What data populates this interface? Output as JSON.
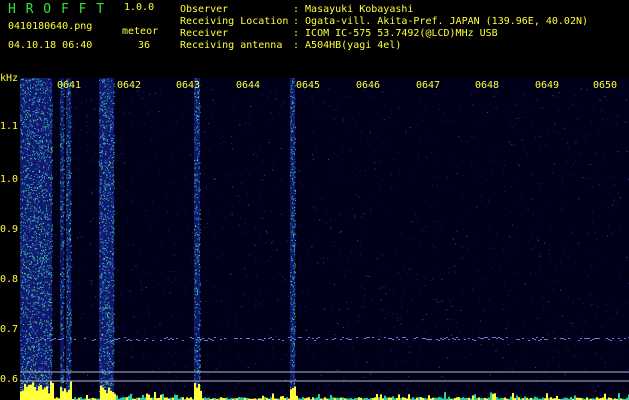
{
  "app": {
    "name": "H R O F F T",
    "version": "1.0.0"
  },
  "file": {
    "name": "0410180640.png",
    "datetime": "04.10.18 06:40"
  },
  "meteor": {
    "label": "meteor",
    "count": "36"
  },
  "info": [
    {
      "key": "Observer",
      "value": ": Masayuki Kobayashi"
    },
    {
      "key": "Receiving Location",
      "value": ": Ogata-vill. Akita-Pref. JAPAN (139.96E, 40.02N)"
    },
    {
      "key": "Receiver",
      "value": ": ICOM IC-575 53.7492(@LCD)MHz USB"
    },
    {
      "key": "Receiving antenna",
      "value": ": A504HB(yagi 4el)"
    }
  ],
  "axis": {
    "unit": "kHz",
    "y_ticks": [
      "1.1",
      "1.0",
      "0.9",
      "0.8",
      "0.7",
      "0.6"
    ],
    "x_ticks": [
      "0641",
      "0642",
      "0643",
      "0644",
      "0645",
      "0646",
      "0647",
      "0648",
      "0649",
      "0650"
    ]
  },
  "colors": {
    "label": "#39e039",
    "text": "#ffff3a",
    "background": "#000000",
    "noise": "#1a1aa0",
    "signal": "#2fd0a0"
  }
}
